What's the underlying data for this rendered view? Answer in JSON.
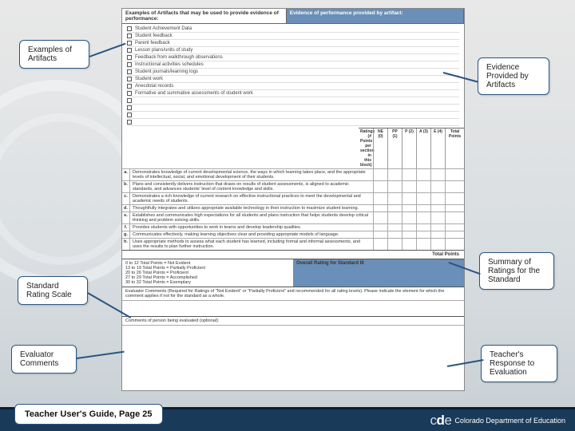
{
  "header": {
    "col1": "Examples of Artifacts that may be used to provide evidence of performance:",
    "col2": "Evidence of performance provided by artifact:"
  },
  "artifacts": [
    "Student Achievement Data",
    "Student feedback",
    "Parent feedback",
    "Lesson plans/units of study",
    "Feedback from walkthrough observations",
    "Instructional activities schedules",
    "Student journals/learning logs",
    "Student work",
    "Anecdotal records",
    "Formative and summative assessments of student work",
    "",
    "",
    "",
    ""
  ],
  "ratings_header": {
    "label": "Ratings (# Points per section in this block)",
    "cols": [
      "NE (0)",
      "PP (1)",
      "P (2)",
      "A (3)",
      "E (4)",
      "Total Points"
    ]
  },
  "standards": [
    {
      "n": "a.",
      "d": "Demonstrates knowledge of current developmental science, the ways in which learning takes place, and the appropriate levels of intellectual, social, and emotional development of their students."
    },
    {
      "n": "b.",
      "d": "Plans and consistently delivers instruction that draws on results of student assessments, is aligned to academic standards, and advances students' level of content knowledge and skills."
    },
    {
      "n": "c.",
      "d": "Demonstrates a rich knowledge of current research on effective instructional practices to meet the developmental and academic needs of students."
    },
    {
      "n": "d.",
      "d": "Thoughtfully integrates and utilizes appropriate available technology in their instruction to maximize student learning."
    },
    {
      "n": "e.",
      "d": "Establishes and communicates high expectations for all students and plans instruction that helps students develop critical thinking and problem solving skills."
    },
    {
      "n": "f.",
      "d": "Provides students with opportunities to work in teams and develop leadership qualities."
    },
    {
      "n": "g.",
      "d": "Communicates effectively, making learning objectives clear and providing appropriate models of language."
    },
    {
      "n": "h.",
      "d": "Uses appropriate methods to assess what each student has learned, including formal and informal assessments, and uses the results to plan further instruction."
    }
  ],
  "total_label": "Total Points",
  "overall_label": "Overall Rating for Standard III",
  "scale": [
    "0 to 12 Total Points = Not Evident",
    "13 to 19 Total Points = Partially Proficient",
    "20 to 26 Total Points = Proficient",
    "27 to 29 Total Points = Accomplished",
    "30 to 32 Total Points = Exemplary"
  ],
  "eval_comments_header": "Evaluator Comments (Required for Ratings of \"Not Evident\" or \"Partially Proficient\" and recommended for all rating levels). Please indicate the element for which the comment applies if not for the standard as a whole.",
  "person_comments_header": "Comments of person being evaluated (optional):",
  "callouts": {
    "examples": "Examples of Artifacts",
    "evidence": "Evidence Provided by Artifacts",
    "scale": "Standard Rating Scale",
    "summary": "Summary of Ratings for the Standard",
    "evaluator": "Evaluator Comments",
    "response": "Teacher's Response to Evaluation"
  },
  "footer": {
    "page_ref": "Teacher User's Guide, Page 25",
    "logo_text": "Colorado Department of Education"
  }
}
